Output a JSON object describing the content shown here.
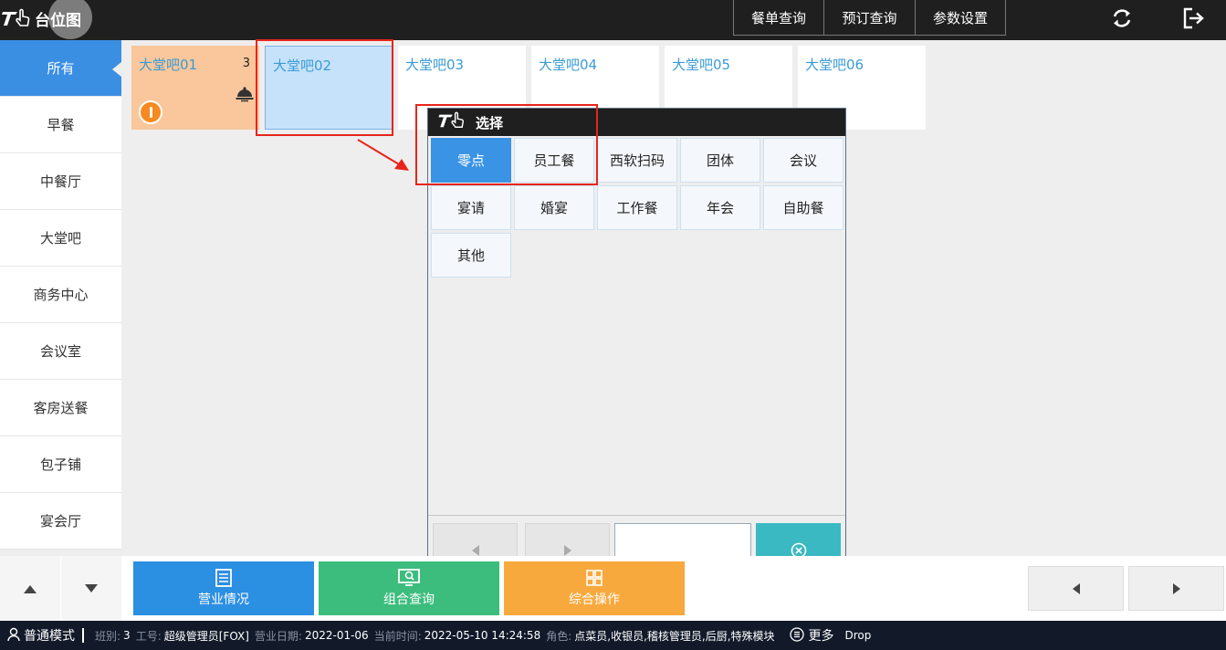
{
  "app": {
    "title": "台位图",
    "logo_icon": "hand-pointer-logo-icon"
  },
  "top_nav": {
    "buttons": [
      "餐单查询",
      "预订查询",
      "参数设置"
    ]
  },
  "sidebar": {
    "items": [
      "所有",
      "早餐",
      "中餐厅",
      "大堂吧",
      "商务中心",
      "会议室",
      "客房送餐",
      "包子铺",
      "宴会厅"
    ],
    "active_index": 0
  },
  "tables": [
    {
      "name": "大堂吧01",
      "count": "3",
      "status": "occupied"
    },
    {
      "name": "大堂吧02",
      "count": "",
      "status": "selected"
    },
    {
      "name": "大堂吧03",
      "count": "",
      "status": "free"
    },
    {
      "name": "大堂吧04",
      "count": "",
      "status": "free"
    },
    {
      "name": "大堂吧05",
      "count": "",
      "status": "free"
    },
    {
      "name": "大堂吧06",
      "count": "",
      "status": "free"
    }
  ],
  "dialog": {
    "title": "选择",
    "options": [
      "零点",
      "员工餐",
      "西软扫码",
      "团体",
      "会议",
      "宴请",
      "婚宴",
      "工作餐",
      "年会",
      "自助餐",
      "其他"
    ],
    "active_index": 0,
    "input_value": ""
  },
  "bottom_actions": [
    {
      "label": "营业情况",
      "color": "#2b8fe2",
      "icon": "document-list-icon"
    },
    {
      "label": "组合查询",
      "color": "#3dbd7d",
      "icon": "monitor-search-icon"
    },
    {
      "label": "综合操作",
      "color": "#f8a93d",
      "icon": "grid-apps-icon"
    }
  ],
  "status": {
    "mode": "普通模式",
    "shift_label": "班别:",
    "shift": "3",
    "staff_label": "工号:",
    "staff": "超级管理员[FOX]",
    "bizdate_label": "营业日期:",
    "bizdate": "2022-01-06",
    "time_label": "当前时间:",
    "time": "2022-05-10 14:24:58",
    "role_label": "角色:",
    "roles": "点菜员,收银员,稽核管理员,后厨,特殊模块",
    "more": "更多",
    "drop": "Drop"
  },
  "colors": {
    "accent": "#3b8fe3",
    "occupied": "#f9c79b",
    "highlight": "#e8241b",
    "topbar": "#1f1f1f",
    "statusbar": "#121a2a"
  }
}
